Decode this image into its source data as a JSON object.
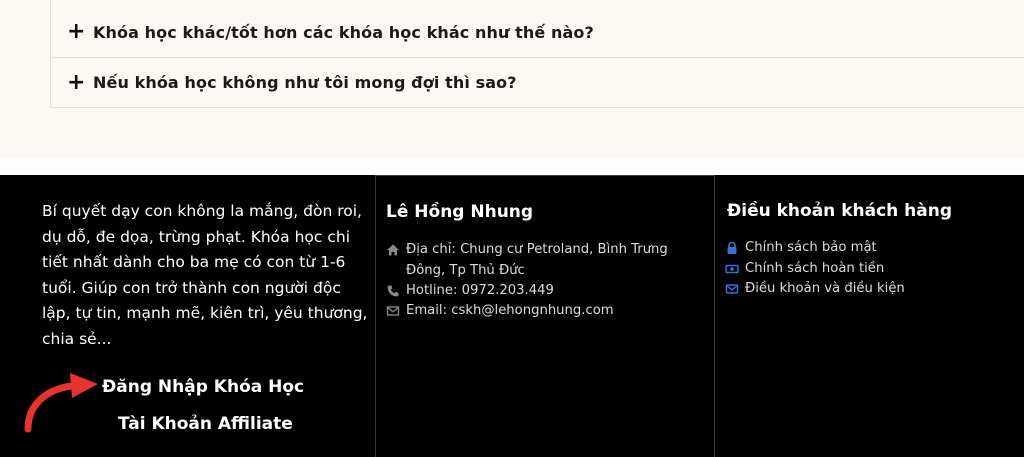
{
  "faq": {
    "items": [
      {
        "icon": "plus-icon",
        "symbol": "+",
        "question": "Khóa học khác/tốt hơn các khóa học khác như thế nào?"
      },
      {
        "icon": "plus-icon",
        "symbol": "+",
        "question": "Nếu khóa học không như tôi mong đợi thì sao?"
      }
    ]
  },
  "footer": {
    "intro": "Bí quyết dạy con không la mắng, đòn roi, dụ dỗ, đe dọa, trừng phạt. Khóa học chi tiết nhất dành cho ba mẹ có con từ 1-6 tuổi. Giúp con trở thành con người độc lập, tự tin, mạnh mẽ, kiên trì, yêu thương, chia sẻ...",
    "login_label": "Đăng Nhập Khóa Học",
    "affiliate_label": "Tài Khoản Affiliate",
    "contact": {
      "title": "Lê Hồng Nhung",
      "address": "Địa chỉ: Chung cư Petroland, Bình Trưng Đông, Tp Thủ Đức",
      "hotline": "Hotline: 0972.203.449",
      "email": "Email: cskh@lehongnhung.com"
    },
    "terms": {
      "title": "Điều khoản khách hàng",
      "links": [
        {
          "icon": "lock-icon",
          "label": "Chính sách bảo mật"
        },
        {
          "icon": "money-icon",
          "label": "Chính sách hoàn tiền"
        },
        {
          "icon": "envelope-icon",
          "label": "Điều khoản và điều kiện"
        }
      ]
    },
    "colors": {
      "background": "#000000",
      "accent_arrow": "#e8322c",
      "icon_blue": "#3b6fd8"
    }
  }
}
